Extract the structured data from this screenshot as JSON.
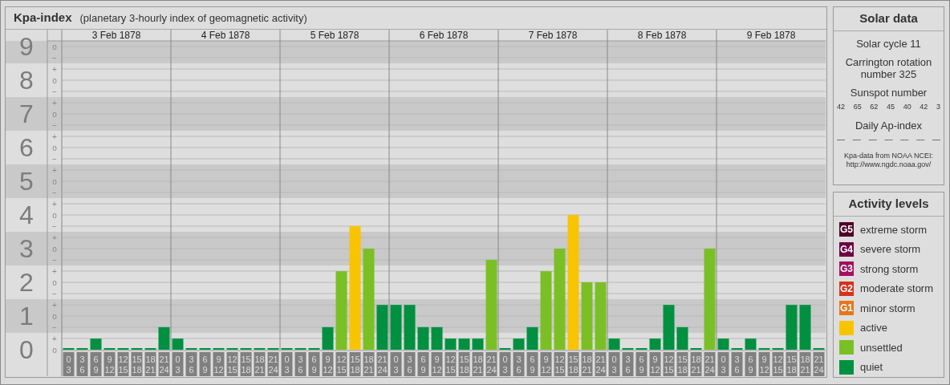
{
  "main_panel": {
    "title": "Kpa-index",
    "subtitle": "(planetary 3-hourly index of geomagnetic activity)",
    "days": [
      "3 Feb 1878",
      "4 Feb 1878",
      "5 Feb 1878",
      "6 Feb 1878",
      "7 Feb 1878",
      "8 Feb 1878",
      "9 Feb 1878"
    ],
    "scale_marks": [
      "o",
      "−",
      "+",
      "o",
      "−",
      "+",
      "o",
      "−",
      "+",
      "o",
      "−",
      "+",
      "o",
      "−",
      "+",
      "o",
      "−",
      "+",
      "o",
      "−",
      "+",
      "o",
      "−",
      "+",
      "o",
      "−",
      "+",
      "o"
    ],
    "chart_data": {
      "type": "bar",
      "ylim": [
        0,
        9
      ],
      "yticks": [
        9,
        8,
        7,
        6,
        5,
        4,
        3,
        2,
        1,
        0
      ],
      "grid": true,
      "categories": [
        "0\n3",
        "3\n6",
        "6\n9",
        "9\n12",
        "12\n15",
        "15\n18",
        "18\n21",
        "21\n24",
        "0\n3",
        "3\n6",
        "6\n9",
        "9\n12",
        "12\n15",
        "15\n18",
        "18\n21",
        "21\n24",
        "0\n3",
        "3\n6",
        "6\n9",
        "9\n12",
        "12\n15",
        "15\n18",
        "18\n21",
        "21\n24",
        "0\n3",
        "3\n6",
        "6\n9",
        "9\n12",
        "12\n15",
        "15\n18",
        "18\n21",
        "21\n24",
        "0\n3",
        "3\n6",
        "6\n9",
        "9\n12",
        "12\n15",
        "15\n18",
        "18\n21",
        "21\n24",
        "0\n3",
        "3\n6",
        "6\n9",
        "9\n12",
        "12\n15",
        "15\n18",
        "18\n21",
        "21\n24",
        "0\n3",
        "3\n6",
        "6\n9",
        "9\n12",
        "12\n15",
        "15\n18",
        "18\n21",
        "21\n24"
      ],
      "series": [
        {
          "color": "#009040",
          "values": [
            0,
            0,
            0.33,
            0,
            0,
            0,
            0,
            0.67,
            0.33,
            0,
            0,
            0,
            0,
            0,
            0,
            0,
            0,
            0,
            0,
            0.67,
            null,
            null,
            null,
            1.33,
            1.33,
            1.33,
            0.67,
            0.67,
            0.33,
            0.33,
            0.33,
            null,
            0,
            0.33,
            0.67,
            null,
            null,
            null,
            null,
            null,
            0.33,
            0,
            0,
            0.33,
            1.33,
            0.67,
            0,
            null,
            0.33,
            0,
            0.33,
            0,
            0,
            1.33,
            1.33,
            0
          ]
        },
        {
          "color": "#7ac025",
          "values": [
            null,
            null,
            null,
            null,
            null,
            null,
            null,
            null,
            null,
            null,
            null,
            null,
            null,
            null,
            null,
            null,
            null,
            null,
            null,
            null,
            2.33,
            null,
            3,
            null,
            null,
            null,
            null,
            null,
            null,
            null,
            null,
            2.67,
            null,
            null,
            null,
            2.33,
            3,
            null,
            2,
            2,
            null,
            null,
            null,
            null,
            null,
            null,
            null,
            3,
            null,
            null,
            null,
            null,
            null,
            null,
            null,
            null
          ]
        },
        {
          "color": "#f8c400",
          "values": [
            null,
            null,
            null,
            null,
            null,
            null,
            null,
            null,
            null,
            null,
            null,
            null,
            null,
            null,
            null,
            null,
            null,
            null,
            null,
            null,
            null,
            3.67,
            null,
            null,
            null,
            null,
            null,
            null,
            null,
            null,
            null,
            null,
            null,
            null,
            null,
            null,
            null,
            4,
            null,
            null,
            null,
            null,
            null,
            null,
            null,
            null,
            null,
            null,
            null,
            null,
            null,
            null,
            null,
            null,
            null,
            null
          ]
        }
      ]
    }
  },
  "solar_data": {
    "title": "Solar data",
    "solar_cycle": "Solar cycle 11",
    "carrington": "Carrington rotation number 325",
    "sunspot_title": "Sunspot number",
    "sunspot_values": [
      "42",
      "65",
      "62",
      "45",
      "40",
      "42",
      "3"
    ],
    "ap_title": "Daily Ap-index",
    "ap_values": [
      "––",
      "––",
      "––",
      "––",
      "––",
      "––",
      "––"
    ],
    "source": "Kpa-data from NOAA NCEI:",
    "source_url": "http://www.ngdc.noaa.gov/"
  },
  "activity_levels": {
    "title": "Activity levels",
    "items": [
      {
        "code": "G5",
        "label": "extreme storm",
        "color": "#4d0026"
      },
      {
        "code": "G4",
        "label": "severe storm",
        "color": "#6e0040"
      },
      {
        "code": "G3",
        "label": "strong storm",
        "color": "#a3105e"
      },
      {
        "code": "G2",
        "label": "moderate storm",
        "color": "#d9301c"
      },
      {
        "code": "G1",
        "label": "minor storm",
        "color": "#e6761b"
      },
      {
        "label": "active",
        "color": "#f8c400"
      },
      {
        "label": "unsettled",
        "color": "#7ac025"
      },
      {
        "label": "quiet",
        "color": "#009040"
      }
    ]
  }
}
